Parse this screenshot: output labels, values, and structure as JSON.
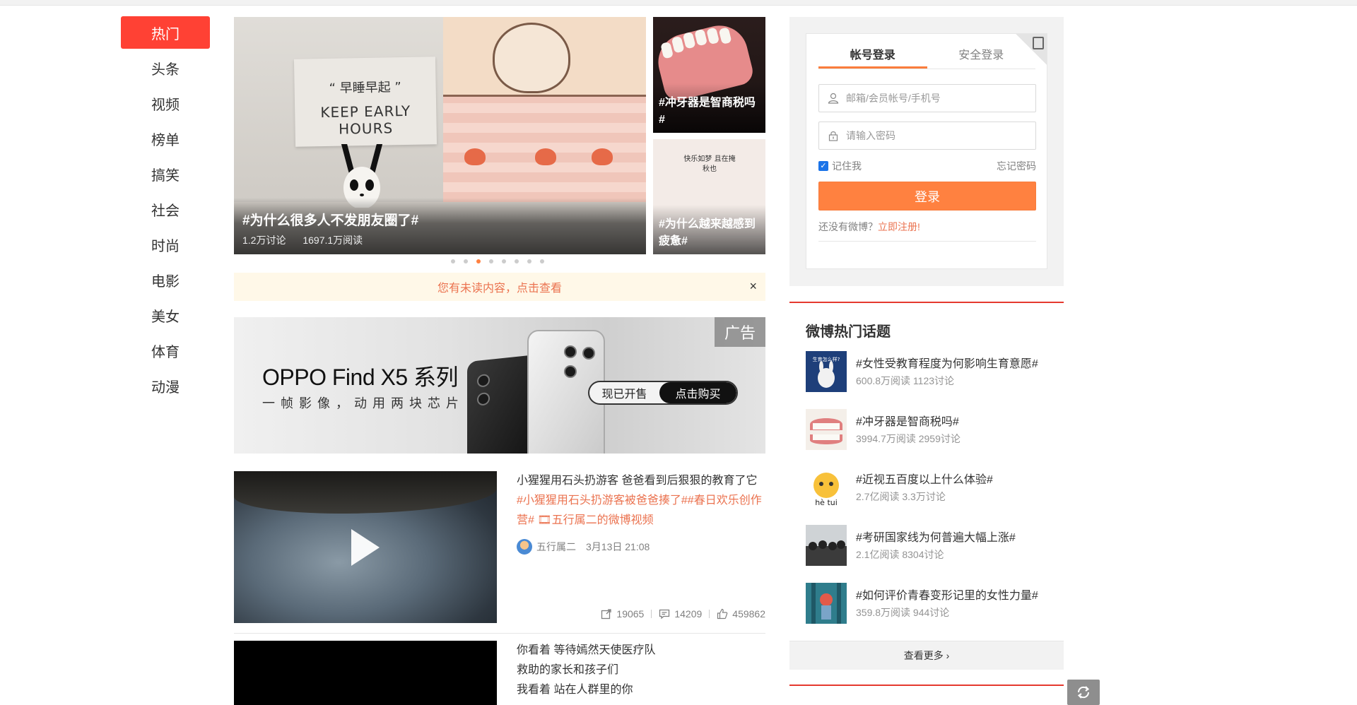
{
  "nav": {
    "items": [
      "热门",
      "头条",
      "视频",
      "榜单",
      "搞笑",
      "社会",
      "时尚",
      "电影",
      "美女",
      "体育",
      "动漫"
    ],
    "active_index": 0
  },
  "carousel": {
    "main": {
      "card_line1": "“ 早睡早起 ”",
      "card_line2": "KEEP EARLY HOURS",
      "title": "#为什么很多人不发朋友圈了#",
      "discuss": "1.2万讨论",
      "reads": "1697.1万阅读"
    },
    "side": [
      {
        "title": "#冲牙器是智商税吗#"
      },
      {
        "title": "#为什么越来越感到疲惫#",
        "note": "快乐如梦 且在掩秋也"
      }
    ],
    "dot_count": 8,
    "active_dot": 2
  },
  "notice": {
    "text": "您有未读内容，点击查看",
    "close": "×"
  },
  "ad": {
    "title": "OPPO Find X5 系列",
    "subtitle": "一帧影像，动用两块芯片",
    "btn_on_sale": "现已开售",
    "btn_buy": "点击购买",
    "badge": "广告"
  },
  "feed": [
    {
      "title": "小猩猩用石头扔游客 爸爸看到后狠狠的教育了它",
      "links": "#小猩猩用石头扔游客被爸爸揍了##春日欢乐创作营# 🎞五行属二的微博视频",
      "user": "五行属二",
      "time": "3月13日 21:08",
      "reposts": "19065",
      "comments": "14209",
      "likes": "459862"
    },
    {
      "lines": [
        "你看着 等待嫣然天使医疗队",
        "救助的家长和孩子们",
        "我看着 站在人群里的你"
      ]
    }
  ],
  "login": {
    "tab_account": "帐号登录",
    "tab_secure": "安全登录",
    "username_placeholder": "邮箱/会员帐号/手机号",
    "password_placeholder": "请输入密码",
    "remember": "记住我",
    "forgot": "忘记密码",
    "login_btn": "登录",
    "no_account": "还没有微博？",
    "register": "立即注册!"
  },
  "hot_topics": {
    "title": "微博热门话题",
    "items": [
      {
        "name": "#女性受教育程度为何影响生育意愿#",
        "meta": "600.8万阅读 1123讨论",
        "thumb_text": "生育怎么样?"
      },
      {
        "name": "#冲牙器是智商税吗#",
        "meta": "3994.7万阅读 2959讨论"
      },
      {
        "name": "#近视五百度以上什么体验#",
        "meta": "2.7亿阅读 3.3万讨论",
        "thumb_text": "hè tui"
      },
      {
        "name": "#考研国家线为何普遍大幅上涨#",
        "meta": "2.1亿阅读 8304讨论"
      },
      {
        "name": "#如何评价青春变形记里的女性力量#",
        "meta": "359.8万阅读 944讨论"
      }
    ],
    "more": "查看更多 ›"
  },
  "colors": {
    "accent_red": "#ff4134",
    "accent_orange": "#ff8140",
    "link_orange": "#eb7350"
  }
}
